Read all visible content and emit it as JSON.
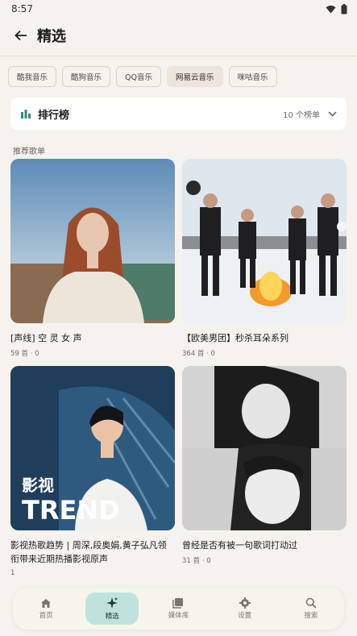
{
  "status": {
    "time": "8:57"
  },
  "header": {
    "title": "精选"
  },
  "sources": [
    "酷我音乐",
    "酷狗音乐",
    "QQ音乐",
    "网易云音乐",
    "咪咕音乐"
  ],
  "selected_source_index": 3,
  "rank": {
    "title": "排行榜",
    "count": "10 个榜单"
  },
  "section_label": "推荐歌单",
  "playlists": [
    {
      "title": "[声线] 空 灵 女 声",
      "meta": "59 首 · 0"
    },
    {
      "title": "【欧美男团】秒杀耳朵系列",
      "meta": "364 首 · 0"
    },
    {
      "title": "影视热歌趋势 | 周深,段奥娟,黄子弘凡领衔带来近期热播影视原声",
      "meta": "1",
      "cover_text": "影视",
      "cover_text2": "TREND"
    },
    {
      "title": "曾经是否有被一句歌词打动过",
      "meta": "31 首 · 0"
    }
  ],
  "nav": [
    {
      "label": "首页",
      "icon": "home-icon"
    },
    {
      "label": "精选",
      "icon": "sparkle-icon"
    },
    {
      "label": "媒体库",
      "icon": "library-icon"
    },
    {
      "label": "设置",
      "icon": "gear-icon"
    },
    {
      "label": "搜索",
      "icon": "search-icon"
    }
  ],
  "colors": {
    "accent": "#bfe3dc",
    "rank_icon": "#2e8b7a",
    "background": "#f6f3ee"
  }
}
